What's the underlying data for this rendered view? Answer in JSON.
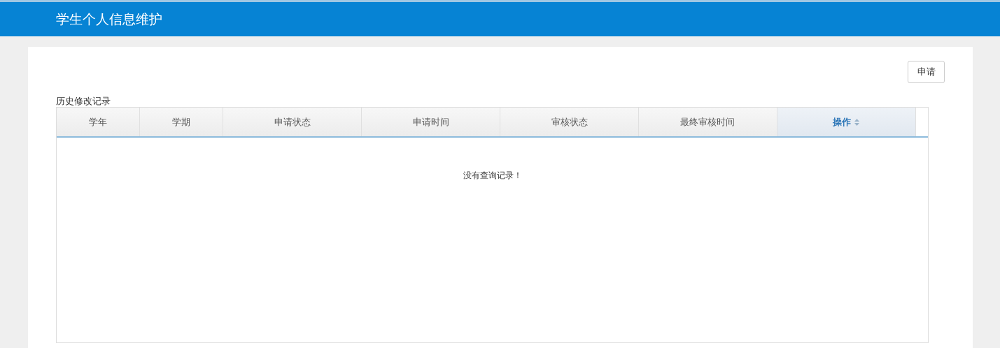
{
  "header": {
    "title": "学生个人信息维护"
  },
  "apply_button": "申请",
  "section_title": "历史修改记录",
  "table": {
    "columns": [
      {
        "label": "学年",
        "sorted": false
      },
      {
        "label": "学期",
        "sorted": false
      },
      {
        "label": "申请状态",
        "sorted": false
      },
      {
        "label": "申请时间",
        "sorted": false
      },
      {
        "label": "审核状态",
        "sorted": false
      },
      {
        "label": "最终审核时间",
        "sorted": false
      },
      {
        "label": "操作",
        "sorted": true
      }
    ],
    "empty_message": "没有查询记录！"
  }
}
